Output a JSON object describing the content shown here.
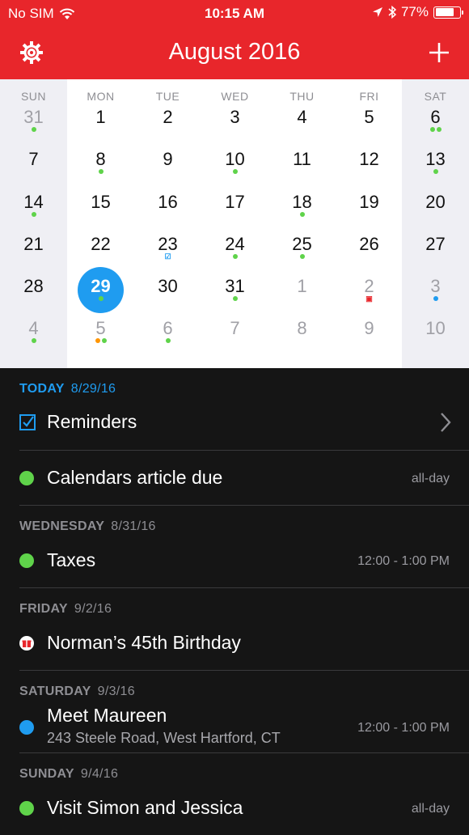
{
  "status_bar": {
    "carrier": "No SIM",
    "time": "10:15 AM",
    "battery": "77%",
    "battery_level": 0.77
  },
  "header": {
    "title": "August 2016",
    "settings_icon": "gear-icon",
    "add_icon": "plus-icon"
  },
  "colors": {
    "accent_red": "#e8262b",
    "today_blue": "#1f9cf0",
    "green": "#5fd34a",
    "orange": "#ff9500",
    "blue": "#1f9cf0"
  },
  "calendar": {
    "weekdays": [
      "SUN",
      "MON",
      "TUE",
      "WED",
      "THU",
      "FRI",
      "SAT"
    ],
    "weeks": [
      [
        {
          "d": "31",
          "o": true,
          "m": [
            "g"
          ]
        },
        {
          "d": "1",
          "m": []
        },
        {
          "d": "2",
          "m": []
        },
        {
          "d": "3",
          "m": []
        },
        {
          "d": "4",
          "m": []
        },
        {
          "d": "5",
          "m": []
        },
        {
          "d": "6",
          "m": [
            "g",
            "g"
          ]
        }
      ],
      [
        {
          "d": "7",
          "m": []
        },
        {
          "d": "8",
          "m": [
            "g"
          ]
        },
        {
          "d": "9",
          "m": []
        },
        {
          "d": "10",
          "m": [
            "g"
          ]
        },
        {
          "d": "11",
          "m": []
        },
        {
          "d": "12",
          "m": []
        },
        {
          "d": "13",
          "m": [
            "g"
          ]
        }
      ],
      [
        {
          "d": "14",
          "m": [
            "g"
          ]
        },
        {
          "d": "15",
          "m": []
        },
        {
          "d": "16",
          "m": []
        },
        {
          "d": "17",
          "m": []
        },
        {
          "d": "18",
          "m": [
            "g"
          ]
        },
        {
          "d": "19",
          "m": []
        },
        {
          "d": "20",
          "m": []
        }
      ],
      [
        {
          "d": "21",
          "m": []
        },
        {
          "d": "22",
          "m": []
        },
        {
          "d": "23",
          "m": [
            "check"
          ]
        },
        {
          "d": "24",
          "m": [
            "g"
          ]
        },
        {
          "d": "25",
          "m": [
            "g"
          ]
        },
        {
          "d": "26",
          "m": []
        },
        {
          "d": "27",
          "m": []
        }
      ],
      [
        {
          "d": "28",
          "m": []
        },
        {
          "d": "29",
          "today": true,
          "m": [
            "g"
          ]
        },
        {
          "d": "30",
          "m": []
        },
        {
          "d": "31",
          "m": [
            "g"
          ]
        },
        {
          "d": "1",
          "o": true,
          "m": []
        },
        {
          "d": "2",
          "o": true,
          "m": [
            "gift"
          ]
        },
        {
          "d": "3",
          "o": true,
          "m": [
            "b"
          ]
        }
      ],
      [
        {
          "d": "4",
          "o": true,
          "m": [
            "g"
          ]
        },
        {
          "d": "5",
          "o": true,
          "m": [
            "o",
            "g"
          ]
        },
        {
          "d": "6",
          "o": true,
          "m": [
            "g"
          ]
        },
        {
          "d": "7",
          "o": true,
          "m": []
        },
        {
          "d": "8",
          "o": true,
          "m": []
        },
        {
          "d": "9",
          "o": true,
          "m": []
        },
        {
          "d": "10",
          "o": true,
          "m": []
        }
      ]
    ]
  },
  "agenda": {
    "sections": [
      {
        "day": "TODAY",
        "date": "8/29/16",
        "is_today": true,
        "events": [
          {
            "lead": "checkbox",
            "title": "Reminders",
            "time": "",
            "chevron": true
          },
          {
            "lead": "dot",
            "color": "#5fd34a",
            "title": "Calendars article due",
            "time": "all-day"
          }
        ]
      },
      {
        "day": "WEDNESDAY",
        "date": "8/31/16",
        "events": [
          {
            "lead": "dot",
            "color": "#5fd34a",
            "title": "Taxes",
            "time": "12:00 - 1:00 PM"
          }
        ]
      },
      {
        "day": "FRIDAY",
        "date": "9/2/16",
        "events": [
          {
            "lead": "gift",
            "title": "Norman’s 45th Birthday",
            "time": ""
          }
        ]
      },
      {
        "day": "SATURDAY",
        "date": "9/3/16",
        "events": [
          {
            "lead": "dot",
            "color": "#1f9cf0",
            "title": "Meet Maureen",
            "subtitle": "243 Steele Road, West Hartford, CT",
            "time": "12:00 - 1:00 PM"
          }
        ]
      },
      {
        "day": "SUNDAY",
        "date": "9/4/16",
        "events": [
          {
            "lead": "dot",
            "color": "#5fd34a",
            "title": "Visit Simon and Jessica",
            "time": "all-day"
          }
        ]
      }
    ]
  }
}
